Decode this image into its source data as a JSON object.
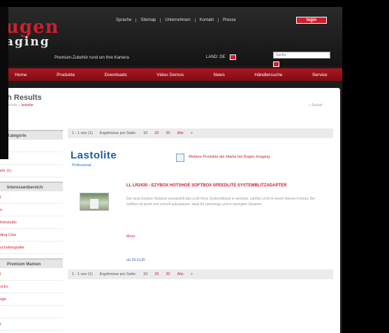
{
  "brand": {
    "name_line1": "ugen",
    "name_line2": "aging"
  },
  "topnav": [
    "Sprache",
    "Sitemap",
    "Unternehmen",
    "Kontakt",
    "Presse"
  ],
  "login_label": "login",
  "tagline": "Premium-Zubehör rund um Ihre Kamera",
  "land_label": "LAND: DE",
  "search": {
    "placeholder": "Suche"
  },
  "mainnav": [
    "Home",
    "Produkte",
    "Downloads",
    "Video Demos",
    "News",
    "Händlersuche",
    "Service"
  ],
  "page_title": "ch Results",
  "breadcrumb": {
    "prefix": "Startseite »",
    "current": "lastolite"
  },
  "back_link": "« Zurück",
  "sidebar": {
    "section1": {
      "title": "Kategorie",
      "items": [
        "e (1)",
        "",
        "ehr (1)"
      ]
    },
    "section2": {
      "title": "Interessenbereich",
      "items": [
        "t",
        "o",
        "fotostudio",
        "ding Cine",
        "uchsfotografie"
      ]
    },
    "section3": {
      "title": "Premium Marken",
      "items": [
        "l",
        "ucks",
        "uge",
        "",
        "t"
      ]
    }
  },
  "pager": {
    "range": "1 - 1 von (1)",
    "per_page_label": "Ergebnisse pro Seite:",
    "options": [
      "10",
      "20",
      "30",
      "Alle"
    ],
    "next": ">"
  },
  "manufacturer": {
    "name": "Lastolite",
    "tagline": "Professional",
    "link": "Weitere Produkte der Marke bei Bogen Imaging"
  },
  "product": {
    "title": "LL LR2430 - EZYBOX HOTSHOE SOFTBOX SPEEDLITE SYSTEMBLITZADAPTER",
    "description": "Die neue Ezybox Hotshoe verwandelt das Licht Ihres Systemblitzes in weiches, sanftes Licht in einem kleinen Format. Die Softbox ist leicht und schnell aufzubauen. Ideal für unterwegs und in beengten Räumen.",
    "more_label": "More",
    "price_label": "ab 89 EUR"
  }
}
